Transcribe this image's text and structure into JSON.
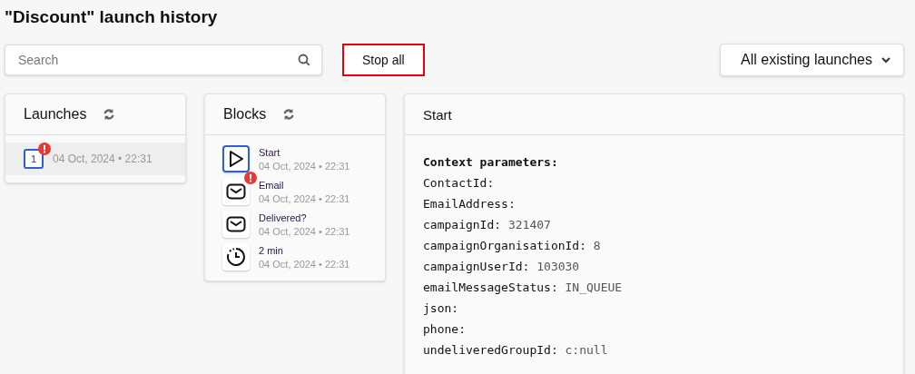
{
  "title": "\"Discount\" launch history",
  "search": {
    "placeholder": "Search"
  },
  "stop_button": {
    "label": "Stop all",
    "highlighted": true
  },
  "filter": {
    "label": "All existing launches"
  },
  "launches": {
    "title": "Launches",
    "items": [
      {
        "number": "1",
        "date": "04 Oct, 2024 • 22:31",
        "selected": true,
        "error": true
      }
    ]
  },
  "blocks": {
    "title": "Blocks",
    "items": [
      {
        "kind": "start",
        "name": "Start",
        "date": "04 Oct, 2024 • 22:31",
        "selected": true,
        "error": false
      },
      {
        "kind": "email",
        "name": "Email",
        "date": "04 Oct, 2024 • 22:31",
        "selected": false,
        "error": true
      },
      {
        "kind": "email",
        "name": "Delivered?",
        "date": "04 Oct, 2024 • 22:31",
        "selected": false,
        "error": false
      },
      {
        "kind": "timer",
        "name": "2 min",
        "date": "04 Oct, 2024 • 22:31",
        "selected": false,
        "error": false
      }
    ]
  },
  "details": {
    "title": "Start",
    "heading": "Context parameters:",
    "params": [
      {
        "key": "ContactId:"
      },
      {
        "key": "EmailAddress:"
      },
      {
        "key": "campaignId:",
        "value": "321407"
      },
      {
        "key": "campaignOrganisationId:",
        "value": "8"
      },
      {
        "key": "campaignUserId:",
        "value": "103030"
      },
      {
        "key": "emailMessageStatus:",
        "value": "IN_QUEUE"
      },
      {
        "key": "json:"
      },
      {
        "key": "phone:"
      },
      {
        "key": "undeliveredGroupId:",
        "value": "c:null"
      }
    ]
  }
}
